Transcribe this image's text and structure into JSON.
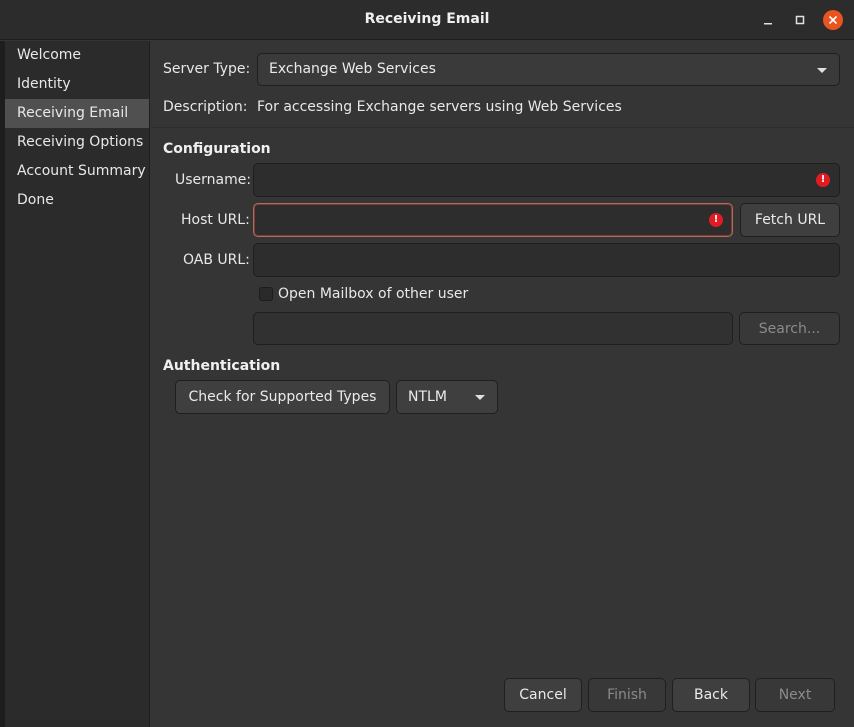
{
  "window": {
    "title": "Receiving Email"
  },
  "sidebar": {
    "items": [
      {
        "label": "Welcome"
      },
      {
        "label": "Identity"
      },
      {
        "label": "Receiving Email"
      },
      {
        "label": "Receiving Options"
      },
      {
        "label": "Account Summary"
      },
      {
        "label": "Done"
      }
    ],
    "active_index": 2
  },
  "form": {
    "server_type_label": "Server Type:",
    "server_type_value": "Exchange Web Services",
    "description_label": "Description:",
    "description_value": "For accessing Exchange servers using Web Services",
    "configuration_heading": "Configuration",
    "username_label": "Username:",
    "username_value": "",
    "host_url_label": "Host URL:",
    "host_url_value": "",
    "fetch_url_label": "Fetch URL",
    "oab_url_label": "OAB URL:",
    "oab_url_value": "",
    "open_mailbox_label": "Open Mailbox of other user",
    "open_mailbox_checked": false,
    "other_user_value": "",
    "search_label": "Search...",
    "authentication_heading": "Authentication",
    "check_types_label": "Check for Supported Types",
    "auth_method_value": "NTLM"
  },
  "footer": {
    "cancel_label": "Cancel",
    "finish_label": "Finish",
    "back_label": "Back",
    "next_label": "Next"
  },
  "colors": {
    "accent_close": "#e95420",
    "error": "#e01b24",
    "active_item": "#505050"
  }
}
